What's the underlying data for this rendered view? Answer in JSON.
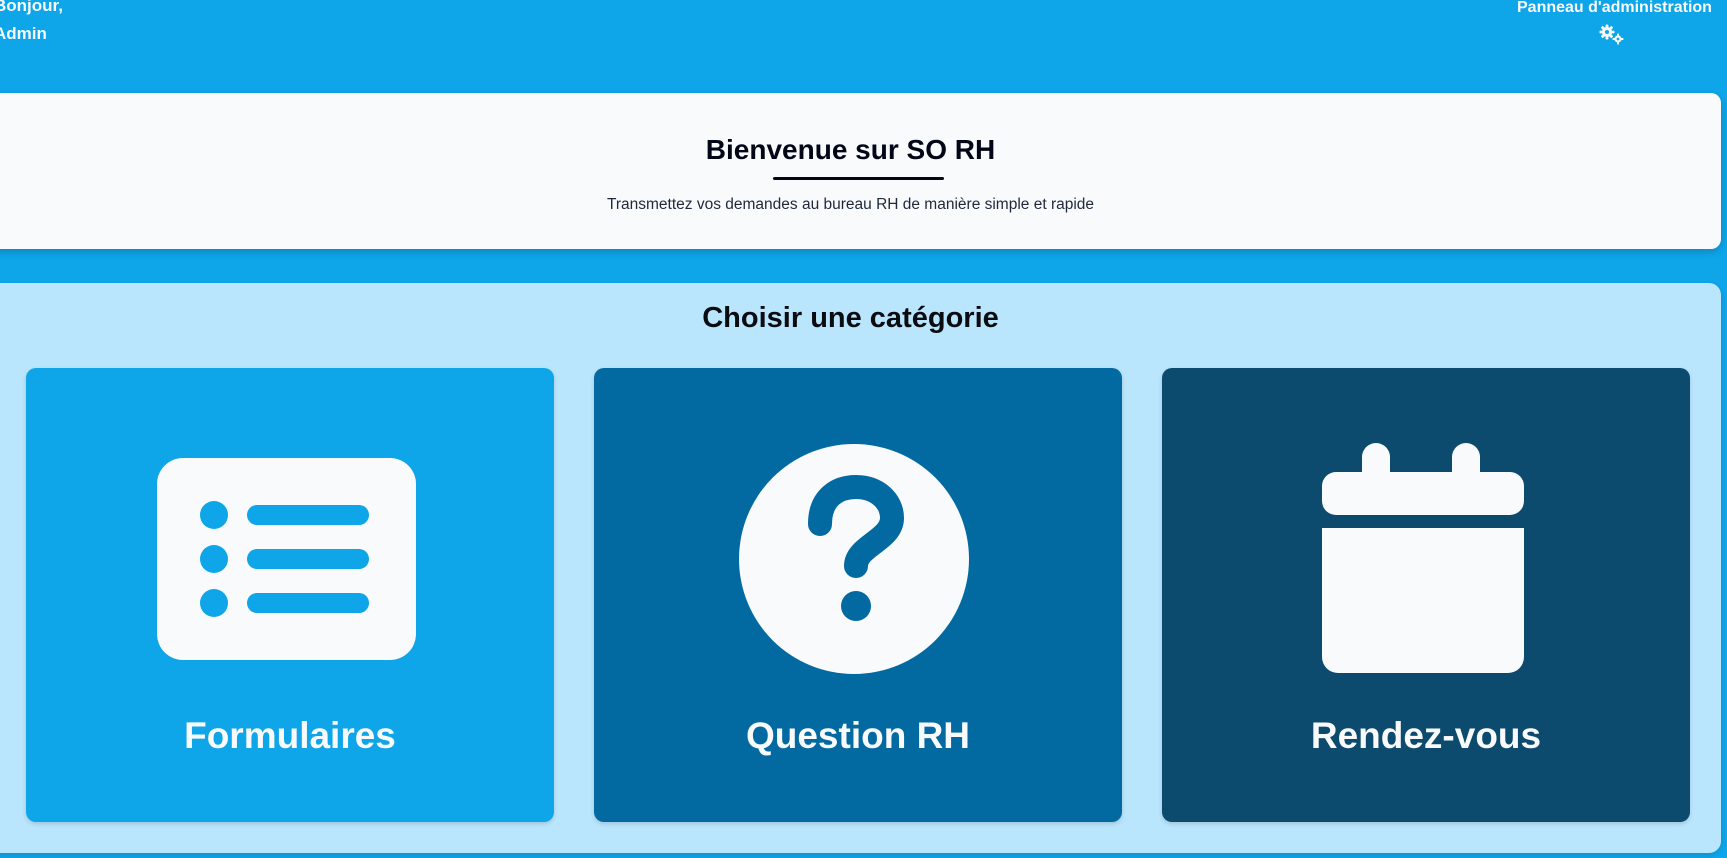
{
  "header": {
    "greeting_line1": "Bonjour,",
    "greeting_line2": "Admin",
    "admin_panel_label": "Panneau d'administration",
    "admin_icon": "gears-icon"
  },
  "welcome": {
    "title": "Bienvenue sur SO RH",
    "subtitle": "Transmettez vos demandes au bureau RH de manière simple et rapide"
  },
  "categories": {
    "heading": "Choisir une catégorie",
    "items": [
      {
        "label": "Formulaires",
        "icon": "list-icon",
        "color": "#0ea5e9"
      },
      {
        "label": "Question RH",
        "icon": "question-circle-icon",
        "color": "#0369a1"
      },
      {
        "label": "Rendez-vous",
        "icon": "calendar-icon",
        "color": "#0c4a6e"
      }
    ]
  },
  "colors": {
    "background": "#0ea5e9",
    "panel": "#f8fafc",
    "categories_panel": "#bae6fd"
  }
}
